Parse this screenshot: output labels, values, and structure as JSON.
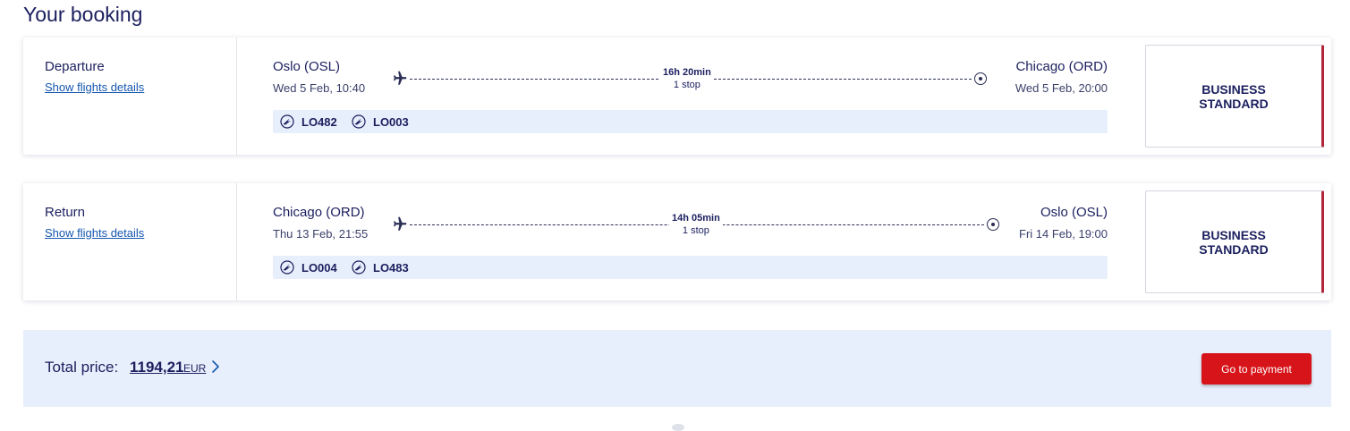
{
  "page": {
    "title": "Your booking"
  },
  "icons": {
    "plane": "plane-icon",
    "destination": "destination-target-icon",
    "airline": "airline-crane-icon",
    "chevron": "chevron-right-icon"
  },
  "colors": {
    "primary_text": "#1b1f5e",
    "link": "#1557b0",
    "accent_red": "#d7141a",
    "fare_border": "#b3263a",
    "highlight_bg": "#e8effc"
  },
  "departure": {
    "label": "Departure",
    "details_link": "Show flights details",
    "from_city": "Oslo (OSL)",
    "from_time": "Wed 5 Feb, 10:40",
    "to_city": "Chicago (ORD)",
    "to_time": "Wed 5 Feb, 20:00",
    "duration": "16h 20min",
    "stops": "1 stop",
    "flights": [
      "LO482",
      "LO003"
    ],
    "fare_line1": "BUSINESS",
    "fare_line2": "STANDARD"
  },
  "return": {
    "label": "Return",
    "details_link": "Show flights details",
    "from_city": "Chicago (ORD)",
    "from_time": "Thu 13 Feb, 21:55",
    "to_city": "Oslo (OSL)",
    "to_time": "Fri 14 Feb, 19:00",
    "duration": "14h 05min",
    "stops": "1 stop",
    "flights": [
      "LO004",
      "LO483"
    ],
    "fare_line1": "BUSINESS",
    "fare_line2": "STANDARD"
  },
  "summary": {
    "total_label": "Total price:",
    "amount": "1194,21",
    "currency": "EUR",
    "pay_button": "Go to payment"
  }
}
